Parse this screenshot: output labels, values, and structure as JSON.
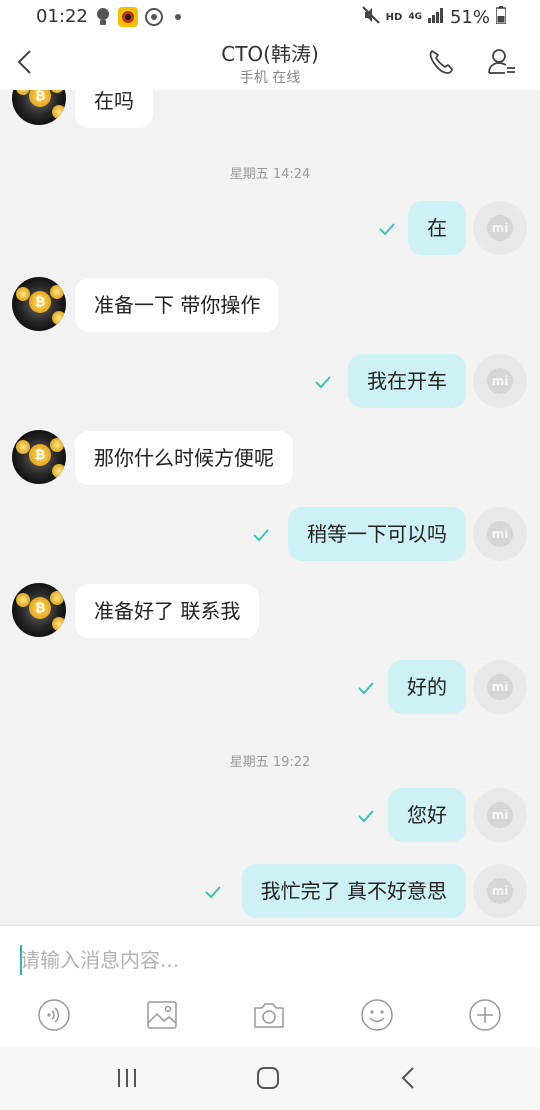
{
  "status_bar": {
    "time": "01:22",
    "network": "HD",
    "signal_type": "4G",
    "battery": "51%"
  },
  "header": {
    "contact_name": "CTO(韩涛)",
    "contact_status": "手机 在线"
  },
  "messages": [
    {
      "from": "contact",
      "text": "在吗"
    },
    {
      "type": "timestamp",
      "text": "星期五 14:24"
    },
    {
      "from": "self",
      "text": "在",
      "status": "read"
    },
    {
      "from": "contact",
      "text": "准备一下  带你操作"
    },
    {
      "from": "self",
      "text": "我在开车",
      "status": "read"
    },
    {
      "from": "contact",
      "text": "那你什么时候方便呢"
    },
    {
      "from": "self",
      "text": "稍等一下可以吗",
      "status": "read"
    },
    {
      "from": "contact",
      "text": "准备好了 联系我"
    },
    {
      "from": "self",
      "text": "好的",
      "status": "read"
    },
    {
      "type": "timestamp",
      "text": "星期五 19:22"
    },
    {
      "from": "self",
      "text": "您好",
      "status": "read"
    },
    {
      "from": "self",
      "text": "我忙完了 真不好意思",
      "status": "read"
    }
  ],
  "input": {
    "placeholder": "请输入消息内容...",
    "value": ""
  },
  "toolbar": [
    "voice-icon",
    "image-icon",
    "camera-icon",
    "emoji-icon",
    "plus-icon"
  ],
  "colors": {
    "outgoing_bubble": "#cdf1f4",
    "incoming_bubble": "#ffffff",
    "read_check": "#3dc3b4",
    "accent": "#2ab3bf"
  }
}
